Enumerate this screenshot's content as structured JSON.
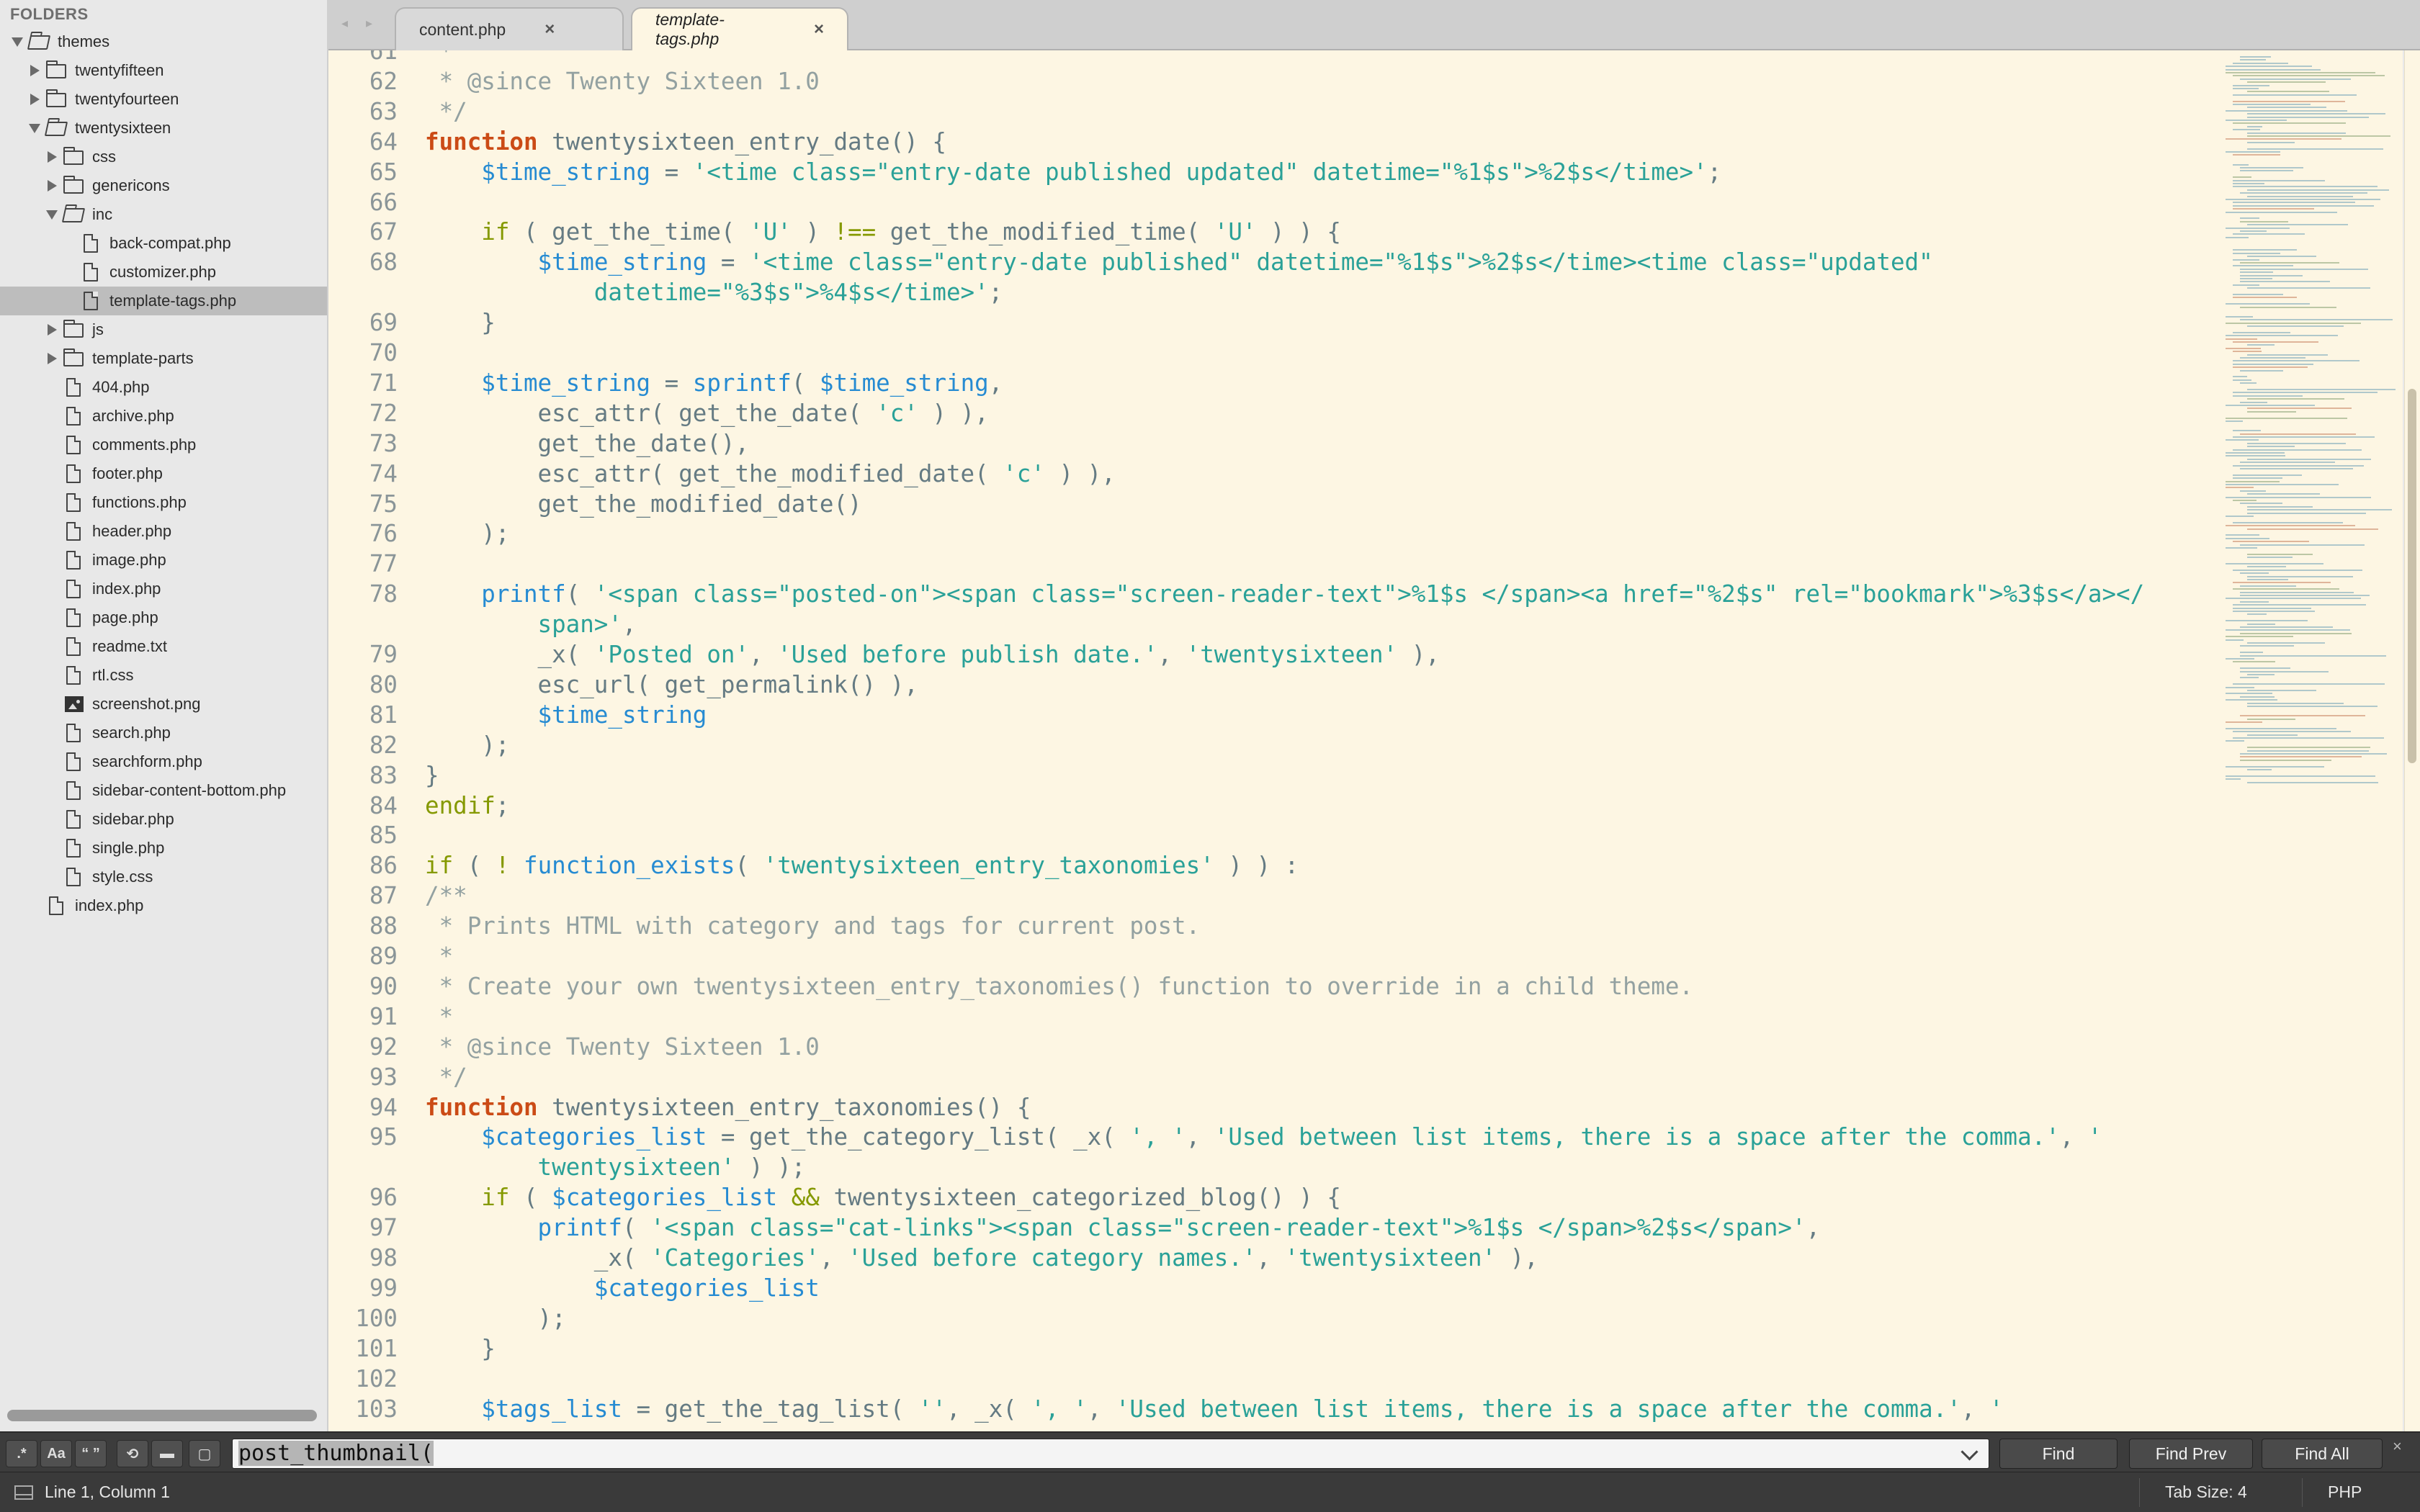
{
  "sidebar": {
    "header": "FOLDERS",
    "tree": [
      {
        "label": "themes",
        "type": "folder",
        "depth": 0,
        "expanded": true
      },
      {
        "label": "twentyfifteen",
        "type": "folder",
        "depth": 1,
        "expanded": false
      },
      {
        "label": "twentyfourteen",
        "type": "folder",
        "depth": 1,
        "expanded": false
      },
      {
        "label": "twentysixteen",
        "type": "folder",
        "depth": 1,
        "expanded": true
      },
      {
        "label": "css",
        "type": "folder",
        "depth": 2,
        "expanded": false
      },
      {
        "label": "genericons",
        "type": "folder",
        "depth": 2,
        "expanded": false
      },
      {
        "label": "inc",
        "type": "folder",
        "depth": 2,
        "expanded": true
      },
      {
        "label": "back-compat.php",
        "type": "file",
        "depth": 3
      },
      {
        "label": "customizer.php",
        "type": "file",
        "depth": 3
      },
      {
        "label": "template-tags.php",
        "type": "file",
        "depth": 3,
        "selected": true
      },
      {
        "label": "js",
        "type": "folder",
        "depth": 2,
        "expanded": false
      },
      {
        "label": "template-parts",
        "type": "folder",
        "depth": 2,
        "expanded": false
      },
      {
        "label": "404.php",
        "type": "file",
        "depth": 2
      },
      {
        "label": "archive.php",
        "type": "file",
        "depth": 2
      },
      {
        "label": "comments.php",
        "type": "file",
        "depth": 2
      },
      {
        "label": "footer.php",
        "type": "file",
        "depth": 2
      },
      {
        "label": "functions.php",
        "type": "file",
        "depth": 2
      },
      {
        "label": "header.php",
        "type": "file",
        "depth": 2
      },
      {
        "label": "image.php",
        "type": "file",
        "depth": 2
      },
      {
        "label": "index.php",
        "type": "file",
        "depth": 2
      },
      {
        "label": "page.php",
        "type": "file",
        "depth": 2
      },
      {
        "label": "readme.txt",
        "type": "file",
        "depth": 2
      },
      {
        "label": "rtl.css",
        "type": "file",
        "depth": 2
      },
      {
        "label": "screenshot.png",
        "type": "image",
        "depth": 2
      },
      {
        "label": "search.php",
        "type": "file",
        "depth": 2
      },
      {
        "label": "searchform.php",
        "type": "file",
        "depth": 2
      },
      {
        "label": "sidebar-content-bottom.php",
        "type": "file",
        "depth": 2
      },
      {
        "label": "sidebar.php",
        "type": "file",
        "depth": 2
      },
      {
        "label": "single.php",
        "type": "file",
        "depth": 2
      },
      {
        "label": "style.css",
        "type": "file",
        "depth": 2
      },
      {
        "label": "index.php",
        "type": "file",
        "depth": 1
      }
    ]
  },
  "tabs": [
    {
      "label": "content.php",
      "close": "×",
      "active": false
    },
    {
      "label": "template-tags.php",
      "close": "×",
      "active": true
    }
  ],
  "editor": {
    "lines": [
      {
        "n": "61",
        "t": [
          [
            "c",
            " *"
          ]
        ]
      },
      {
        "n": "62",
        "t": [
          [
            "c",
            " * @since Twenty Sixteen 1.0"
          ]
        ]
      },
      {
        "n": "63",
        "t": [
          [
            "c",
            " */"
          ]
        ]
      },
      {
        "n": "64",
        "t": [
          [
            "k",
            "function"
          ],
          [
            "d",
            " twentysixteen_entry_date() {"
          ]
        ]
      },
      {
        "n": "65",
        "t": [
          [
            "d",
            "    "
          ],
          [
            "v",
            "$time_string"
          ],
          [
            "d",
            " = "
          ],
          [
            "s",
            "'<time class=\"entry-date published updated\" datetime=\"%1$s\">%2$s</time>'"
          ],
          [
            "d",
            ";"
          ]
        ]
      },
      {
        "n": "66",
        "t": []
      },
      {
        "n": "67",
        "t": [
          [
            "d",
            "    "
          ],
          [
            "kw",
            "if"
          ],
          [
            "d",
            " ( get_the_time( "
          ],
          [
            "s",
            "'U'"
          ],
          [
            "d",
            " ) "
          ],
          [
            "o",
            "!=="
          ],
          [
            "d",
            " get_the_modified_time( "
          ],
          [
            "s",
            "'U'"
          ],
          [
            "d",
            " ) ) {"
          ]
        ]
      },
      {
        "n": "68",
        "t": [
          [
            "d",
            "        "
          ],
          [
            "v",
            "$time_string"
          ],
          [
            "d",
            " = "
          ],
          [
            "s",
            "'<time class=\"entry-date published\" datetime=\"%1$s\">%2$s</time><time class=\"updated\""
          ]
        ]
      },
      {
        "n": "",
        "t": [
          [
            "s",
            "            datetime=\"%3$s\">%4$s</time>'"
          ],
          [
            "d",
            ";"
          ]
        ]
      },
      {
        "n": "69",
        "t": [
          [
            "d",
            "    }"
          ]
        ]
      },
      {
        "n": "70",
        "t": []
      },
      {
        "n": "71",
        "t": [
          [
            "d",
            "    "
          ],
          [
            "v",
            "$time_string"
          ],
          [
            "d",
            " = "
          ],
          [
            "f",
            "sprintf"
          ],
          [
            "d",
            "( "
          ],
          [
            "v",
            "$time_string"
          ],
          [
            "d",
            ","
          ]
        ]
      },
      {
        "n": "72",
        "t": [
          [
            "d",
            "        esc_attr( get_the_date( "
          ],
          [
            "s",
            "'c'"
          ],
          [
            "d",
            " ) ),"
          ]
        ]
      },
      {
        "n": "73",
        "t": [
          [
            "d",
            "        get_the_date(),"
          ]
        ]
      },
      {
        "n": "74",
        "t": [
          [
            "d",
            "        esc_attr( get_the_modified_date( "
          ],
          [
            "s",
            "'c'"
          ],
          [
            "d",
            " ) ),"
          ]
        ]
      },
      {
        "n": "75",
        "t": [
          [
            "d",
            "        get_the_modified_date()"
          ]
        ]
      },
      {
        "n": "76",
        "t": [
          [
            "d",
            "    );"
          ]
        ]
      },
      {
        "n": "77",
        "t": []
      },
      {
        "n": "78",
        "t": [
          [
            "d",
            "    "
          ],
          [
            "f",
            "printf"
          ],
          [
            "d",
            "( "
          ],
          [
            "s",
            "'<span class=\"posted-on\"><span class=\"screen-reader-text\">%1$s </span><a href=\"%2$s\" rel=\"bookmark\">%3$s</a></"
          ]
        ]
      },
      {
        "n": "",
        "t": [
          [
            "s",
            "        span>'"
          ],
          [
            "d",
            ","
          ]
        ]
      },
      {
        "n": "79",
        "t": [
          [
            "d",
            "        _x( "
          ],
          [
            "s",
            "'Posted on'"
          ],
          [
            "d",
            ", "
          ],
          [
            "s",
            "'Used before publish date.'"
          ],
          [
            "d",
            ", "
          ],
          [
            "s",
            "'twentysixteen'"
          ],
          [
            "d",
            " ),"
          ]
        ]
      },
      {
        "n": "80",
        "t": [
          [
            "d",
            "        esc_url( get_permalink() ),"
          ]
        ]
      },
      {
        "n": "81",
        "t": [
          [
            "d",
            "        "
          ],
          [
            "v",
            "$time_string"
          ]
        ]
      },
      {
        "n": "82",
        "t": [
          [
            "d",
            "    );"
          ]
        ]
      },
      {
        "n": "83",
        "t": [
          [
            "d",
            "}"
          ]
        ]
      },
      {
        "n": "84",
        "t": [
          [
            "kw",
            "endif"
          ],
          [
            "d",
            ";"
          ]
        ]
      },
      {
        "n": "85",
        "t": []
      },
      {
        "n": "86",
        "t": [
          [
            "kw",
            "if"
          ],
          [
            "d",
            " ( "
          ],
          [
            "o",
            "!"
          ],
          [
            "d",
            " "
          ],
          [
            "f",
            "function_exists"
          ],
          [
            "d",
            "( "
          ],
          [
            "s",
            "'twentysixteen_entry_taxonomies'"
          ],
          [
            "d",
            " ) ) :"
          ]
        ]
      },
      {
        "n": "87",
        "t": [
          [
            "c",
            "/**"
          ]
        ]
      },
      {
        "n": "88",
        "t": [
          [
            "c",
            " * Prints HTML with category and tags for current post."
          ]
        ]
      },
      {
        "n": "89",
        "t": [
          [
            "c",
            " *"
          ]
        ]
      },
      {
        "n": "90",
        "t": [
          [
            "c",
            " * Create your own twentysixteen_entry_taxonomies() function to override in a child theme."
          ]
        ]
      },
      {
        "n": "91",
        "t": [
          [
            "c",
            " *"
          ]
        ]
      },
      {
        "n": "92",
        "t": [
          [
            "c",
            " * @since Twenty Sixteen 1.0"
          ]
        ]
      },
      {
        "n": "93",
        "t": [
          [
            "c",
            " */"
          ]
        ]
      },
      {
        "n": "94",
        "t": [
          [
            "k",
            "function"
          ],
          [
            "d",
            " twentysixteen_entry_taxonomies() {"
          ]
        ]
      },
      {
        "n": "95",
        "t": [
          [
            "d",
            "    "
          ],
          [
            "v",
            "$categories_list"
          ],
          [
            "d",
            " = get_the_category_list( _x( "
          ],
          [
            "s",
            "', '"
          ],
          [
            "d",
            ", "
          ],
          [
            "s",
            "'Used between list items, there is a space after the comma.'"
          ],
          [
            "d",
            ", "
          ],
          [
            "s",
            "'"
          ]
        ]
      },
      {
        "n": "",
        "t": [
          [
            "s",
            "        twentysixteen'"
          ],
          [
            "d",
            " ) );"
          ]
        ]
      },
      {
        "n": "96",
        "t": [
          [
            "d",
            "    "
          ],
          [
            "kw",
            "if"
          ],
          [
            "d",
            " ( "
          ],
          [
            "v",
            "$categories_list"
          ],
          [
            "d",
            " "
          ],
          [
            "o",
            "&&"
          ],
          [
            "d",
            " twentysixteen_categorized_blog() ) {"
          ]
        ]
      },
      {
        "n": "97",
        "t": [
          [
            "d",
            "        "
          ],
          [
            "f",
            "printf"
          ],
          [
            "d",
            "( "
          ],
          [
            "s",
            "'<span class=\"cat-links\"><span class=\"screen-reader-text\">%1$s </span>%2$s</span>'"
          ],
          [
            "d",
            ","
          ]
        ]
      },
      {
        "n": "98",
        "t": [
          [
            "d",
            "            _x( "
          ],
          [
            "s",
            "'Categories'"
          ],
          [
            "d",
            ", "
          ],
          [
            "s",
            "'Used before category names.'"
          ],
          [
            "d",
            ", "
          ],
          [
            "s",
            "'twentysixteen'"
          ],
          [
            "d",
            " ),"
          ]
        ]
      },
      {
        "n": "99",
        "t": [
          [
            "d",
            "            "
          ],
          [
            "v",
            "$categories_list"
          ]
        ]
      },
      {
        "n": "100",
        "t": [
          [
            "d",
            "        );"
          ]
        ]
      },
      {
        "n": "101",
        "t": [
          [
            "d",
            "    }"
          ]
        ]
      },
      {
        "n": "102",
        "t": []
      },
      {
        "n": "103",
        "t": [
          [
            "d",
            "    "
          ],
          [
            "v",
            "$tags_list"
          ],
          [
            "d",
            " = get_the_tag_list( "
          ],
          [
            "s",
            "''"
          ],
          [
            "d",
            ", _x( "
          ],
          [
            "s",
            "', '"
          ],
          [
            "d",
            ", "
          ],
          [
            "s",
            "'Used between list items, there is a space after the comma.'"
          ],
          [
            "d",
            ", "
          ],
          [
            "s",
            "'"
          ]
        ]
      }
    ]
  },
  "find": {
    "regex_label": ".*",
    "case_label": "Aa",
    "word_label": "“ ”",
    "query": "post_thumbnail(",
    "find_label": "Find",
    "find_prev_label": "Find Prev",
    "find_all_label": "Find All",
    "close": "×"
  },
  "status": {
    "position": "Line 1, Column 1",
    "tab_size": "Tab Size: 4",
    "syntax": "PHP"
  }
}
